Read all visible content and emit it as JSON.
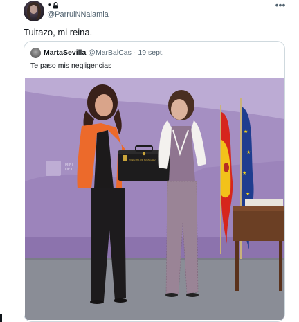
{
  "author": {
    "name": "•",
    "handle": "@ParruiNNalamia",
    "icons": [
      "lock-icon",
      "more-icon"
    ]
  },
  "tweet": {
    "text": "Tuitazo, mi reina."
  },
  "quoted_tweet": {
    "author_name": "MartaSevilla",
    "author_handle": "@MarBalCas",
    "separator": "·",
    "date": "19 sept.",
    "text": "Te paso mis negligencias"
  },
  "photo": {
    "description_icon": "photo-image",
    "briefcase_label": "MINISTRA DE IGUALDAD",
    "backdrop_label": "MINISTERIO DE IGUALDAD"
  },
  "colors": {
    "text": "#0f1419",
    "secondary": "#536471",
    "border": "#cfd9de",
    "backdrop": "#a58fc2"
  }
}
